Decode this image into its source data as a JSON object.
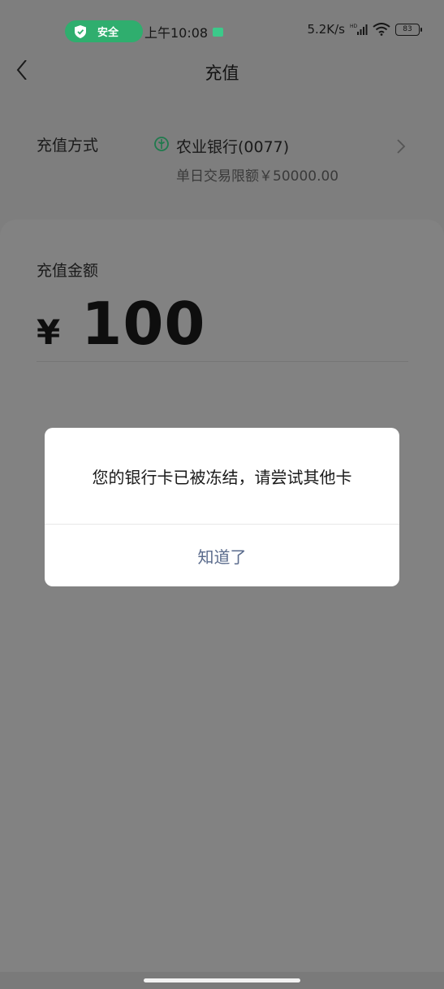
{
  "status_bar": {
    "safe_label": "安全",
    "time": "上午10:08",
    "network_speed": "5.2K/s",
    "network_type": "HD",
    "battery": "83"
  },
  "nav": {
    "title": "充值",
    "back_icon": "chevron-left-icon"
  },
  "method": {
    "label": "充值方式",
    "bank_name": "农业银行(0077)",
    "daily_limit": "单日交易限额￥50000.00",
    "bank_logo_icon": "abc-bank-logo",
    "chevron_icon": "chevron-right-icon"
  },
  "amount": {
    "label": "充值金额",
    "currency": "¥",
    "value": "100"
  },
  "dialog": {
    "message": "您的银行卡已被冻结，请尝试其他卡",
    "button": "知道了"
  },
  "colors": {
    "overlay": "#7e7e7e",
    "safe_pill": "#2fae6e",
    "dialog_button_text": "#5a6b8c",
    "bank_logo": "#1f7a4d"
  }
}
